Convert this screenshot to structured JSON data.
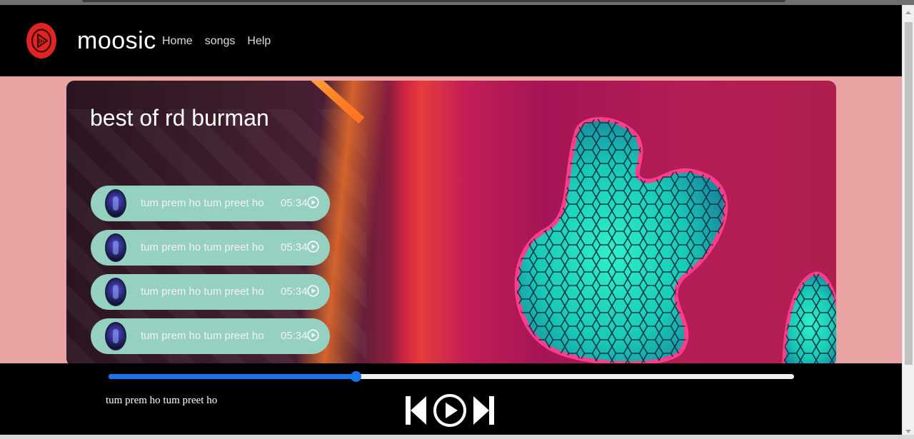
{
  "navbar": {
    "brand": "moosic",
    "links": [
      {
        "label": "Home"
      },
      {
        "label": "songs"
      },
      {
        "label": "Help"
      }
    ],
    "logo_icon": "music-play-logo",
    "accent_color": "#e02424"
  },
  "hero": {
    "title": "best of rd burman",
    "songs": [
      {
        "title": "tum prem ho tum preet ho",
        "duration": "05:34",
        "icon": "play-circle-icon"
      },
      {
        "title": "tum prem ho tum preet ho",
        "duration": "05:34",
        "icon": "play-circle-icon"
      },
      {
        "title": "tum prem ho tum preet ho",
        "duration": "05:34",
        "icon": "play-circle-icon"
      },
      {
        "title": "tum prem ho tum preet ho",
        "duration": "05:34",
        "icon": "play-circle-icon"
      }
    ],
    "song_pill_color": "#96d0c0"
  },
  "player": {
    "now_playing": "tum prem ho tum preet ho",
    "progress_fraction": 0.36,
    "progress_color": "#1a73e8",
    "controls": [
      "skip-back-icon",
      "play-circle-icon",
      "skip-forward-icon"
    ]
  }
}
